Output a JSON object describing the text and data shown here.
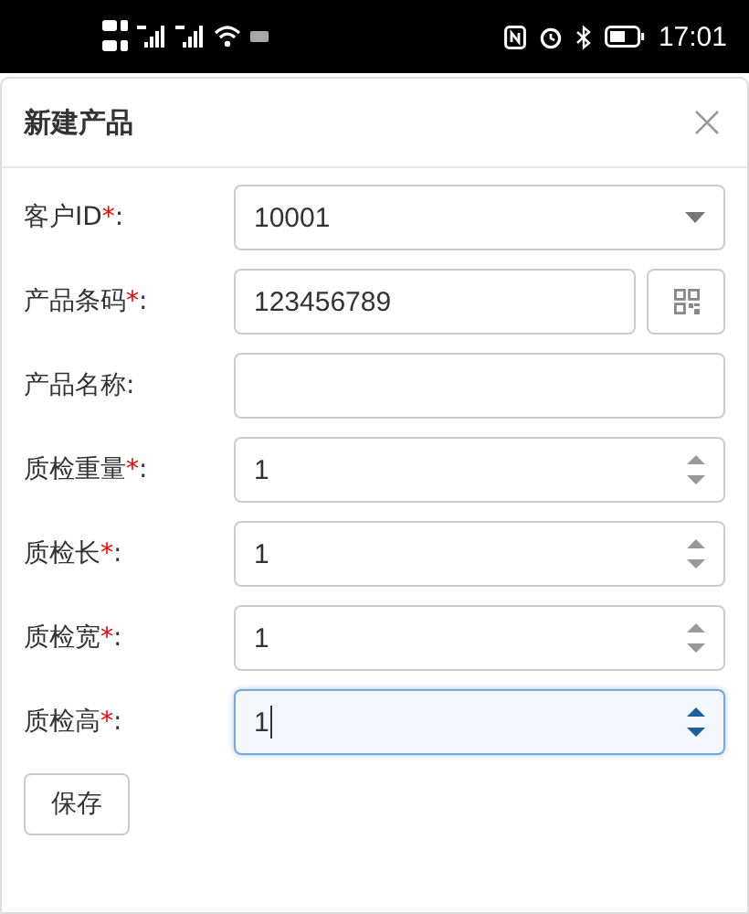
{
  "status_bar": {
    "time": "17:01"
  },
  "dialog": {
    "title": "新建产品"
  },
  "fields": [
    {
      "kind": "select",
      "label": "客户ID",
      "required_mark": "*",
      "colon": ":",
      "value": "10001",
      "focused": false
    },
    {
      "kind": "scan",
      "label": "产品条码",
      "required_mark": "*",
      "colon": ":",
      "value": "123456789",
      "focused": false
    },
    {
      "kind": "text",
      "label": "产品名称",
      "colon": ":",
      "focused": false
    },
    {
      "kind": "number",
      "label": "质检重量",
      "required_mark": "*",
      "colon": ":",
      "value": "1",
      "focused": false
    },
    {
      "kind": "number",
      "label": "质检长",
      "required_mark": "*",
      "colon": ":",
      "value": "1",
      "focused": false
    },
    {
      "kind": "number",
      "label": "质检宽",
      "required_mark": "*",
      "colon": ":",
      "value": "1",
      "focused": false
    },
    {
      "kind": "number",
      "label": "质检高",
      "required_mark": "*",
      "colon": ":",
      "value": "1",
      "focused": true
    }
  ],
  "save_button": "保存"
}
